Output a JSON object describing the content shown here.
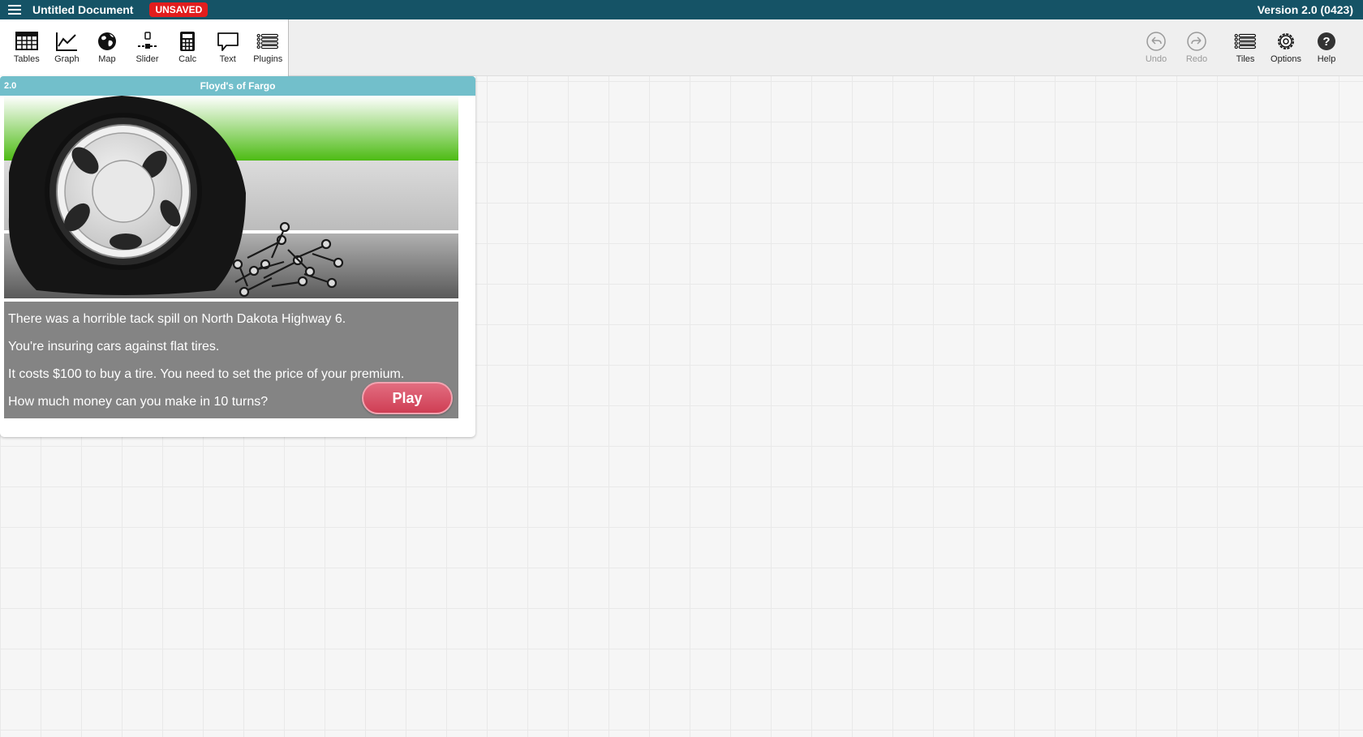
{
  "topbar": {
    "menu_icon": "hamburger-icon",
    "document_title": "Untitled Document",
    "unsaved_badge": "UNSAVED",
    "version": "Version 2.0 (0423)",
    "colors": {
      "bar": "#155366",
      "badge": "#e21d1d"
    }
  },
  "toolbar": {
    "left_tools": [
      {
        "label": "Tables",
        "icon": "table-icon"
      },
      {
        "label": "Graph",
        "icon": "graph-icon"
      },
      {
        "label": "Map",
        "icon": "globe-icon"
      },
      {
        "label": "Slider",
        "icon": "slider-icon"
      },
      {
        "label": "Calc",
        "icon": "calculator-icon"
      },
      {
        "label": "Text",
        "icon": "speech-bubble-icon"
      },
      {
        "label": "Plugins",
        "icon": "plugins-list-icon"
      }
    ],
    "right_tools": [
      {
        "label": "Undo",
        "icon": "undo-icon"
      },
      {
        "label": "Redo",
        "icon": "redo-icon"
      },
      {
        "label": "Tiles",
        "icon": "tiles-list-icon"
      },
      {
        "label": "Options",
        "icon": "gear-icon"
      },
      {
        "label": "Help",
        "icon": "help-icon"
      }
    ]
  },
  "tile": {
    "id_label": "2.0",
    "title": "Floyd's of Fargo",
    "header_color": "#72bfcb",
    "lines": [
      "There was a horrible tack spill on North Dakota Highway 6.",
      "You're insuring cars against flat tires.",
      "It costs $100 to buy a tire. You need to set the price of your premium.",
      "How much money can you make in 10 turns?"
    ],
    "play_label": "Play",
    "play_color": "#cf3e54"
  }
}
